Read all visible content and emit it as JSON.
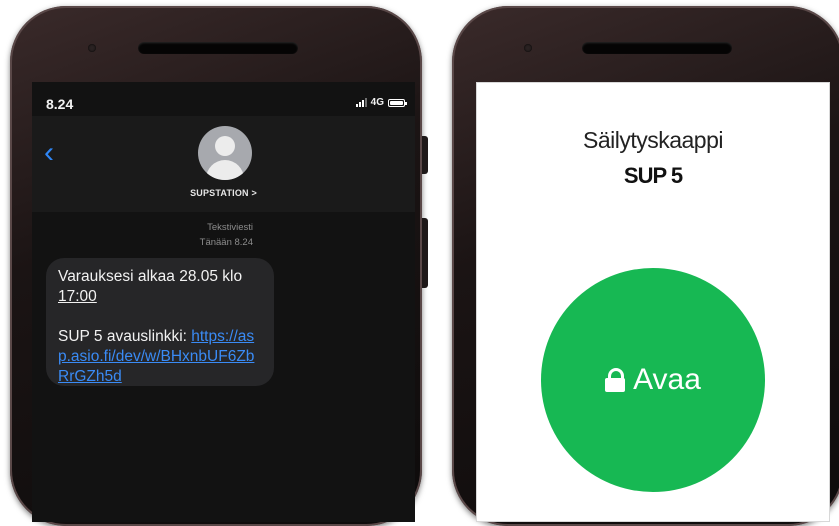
{
  "left_phone": {
    "status": {
      "time": "8.24",
      "network": "4G"
    },
    "header": {
      "contact_name": "SUPSTATION >"
    },
    "message_meta": {
      "type": "Tekstiviesti",
      "timestamp": "Tänään 8.24"
    },
    "message": {
      "line1_prefix": "Varauksesi alkaa 28.05 klo ",
      "line1_time": "17:00",
      "line2_prefix": "SUP 5 avauslinkki: ",
      "link": "https://asp.asio.fi/dev/w/BHxnbUF6ZbRrGZh5d"
    },
    "icons": {
      "back": "chevron-left-icon",
      "avatar": "person-avatar-icon",
      "signal": "signal-icon",
      "battery": "battery-icon"
    },
    "colors": {
      "link": "#3a8bf5",
      "back": "#2f86f5",
      "bubble": "#262628"
    }
  },
  "right_phone": {
    "title": "Säilytyskaappi",
    "locker_id": "SUP 5",
    "open_button": {
      "label": "Avaa",
      "icon": "lock-icon"
    },
    "colors": {
      "button": "#17b853"
    }
  }
}
